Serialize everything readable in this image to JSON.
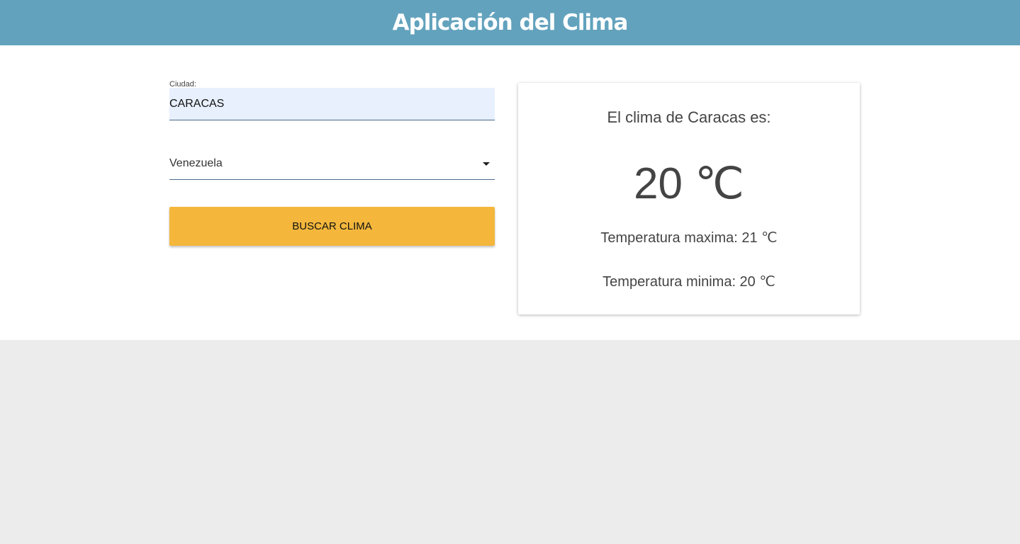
{
  "header": {
    "title": "Aplicación del Clima"
  },
  "form": {
    "city_label": "Ciudad:",
    "city_value": "CARACAS",
    "country_selected": "Venezuela",
    "search_button_label": "BUSCAR CLIMA"
  },
  "result": {
    "title": "El clima de Caracas es:",
    "temperature": "20 ℃",
    "max_temperature": "Temperatura maxima: 21 ℃",
    "min_temperature": "Temperatura minima: 20 ℃"
  },
  "colors": {
    "header_bg": "#62a2bd",
    "button_bg": "#f4b73c",
    "input_bg": "#e8f0fe",
    "page_bg": "#ececec"
  }
}
